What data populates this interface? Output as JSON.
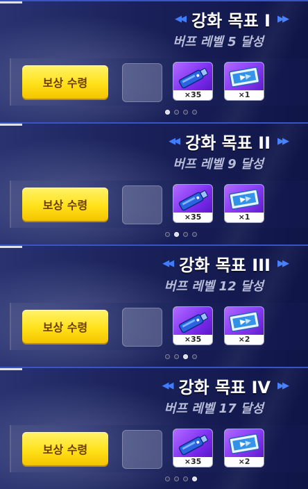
{
  "panels": [
    {
      "title": "강화 목표 I",
      "condition": "버프 레벨 5 달성",
      "claim_label": "보상 수령",
      "rewards": [
        {
          "icon": "blue-usb-drive-icon",
          "count": "×35"
        },
        {
          "icon": "ticket-icon",
          "count": "×1"
        }
      ],
      "pager_active": 1
    },
    {
      "title": "강화 목표 II",
      "condition": "버프 레벨 9 달성",
      "claim_label": "보상 수령",
      "rewards": [
        {
          "icon": "blue-usb-drive-icon",
          "count": "×35"
        },
        {
          "icon": "ticket-icon",
          "count": "×1"
        }
      ],
      "pager_active": 2
    },
    {
      "title": "강화 목표 III",
      "condition": "버프 레벨 12 달성",
      "claim_label": "보상 수령",
      "rewards": [
        {
          "icon": "blue-usb-drive-icon",
          "count": "×35"
        },
        {
          "icon": "ticket-icon",
          "count": "×2"
        }
      ],
      "pager_active": 3
    },
    {
      "title": "강화 목표 IV",
      "condition": "버프 레벨 17 달성",
      "claim_label": "보상 수령",
      "rewards": [
        {
          "icon": "blue-usb-drive-icon",
          "count": "×35"
        },
        {
          "icon": "ticket-icon",
          "count": "×2"
        }
      ],
      "pager_active": 4
    }
  ],
  "colors": {
    "claim_button": "#ffe11a",
    "arrow_accent": "#3f7cff",
    "panel_bg": "#1a215a"
  }
}
